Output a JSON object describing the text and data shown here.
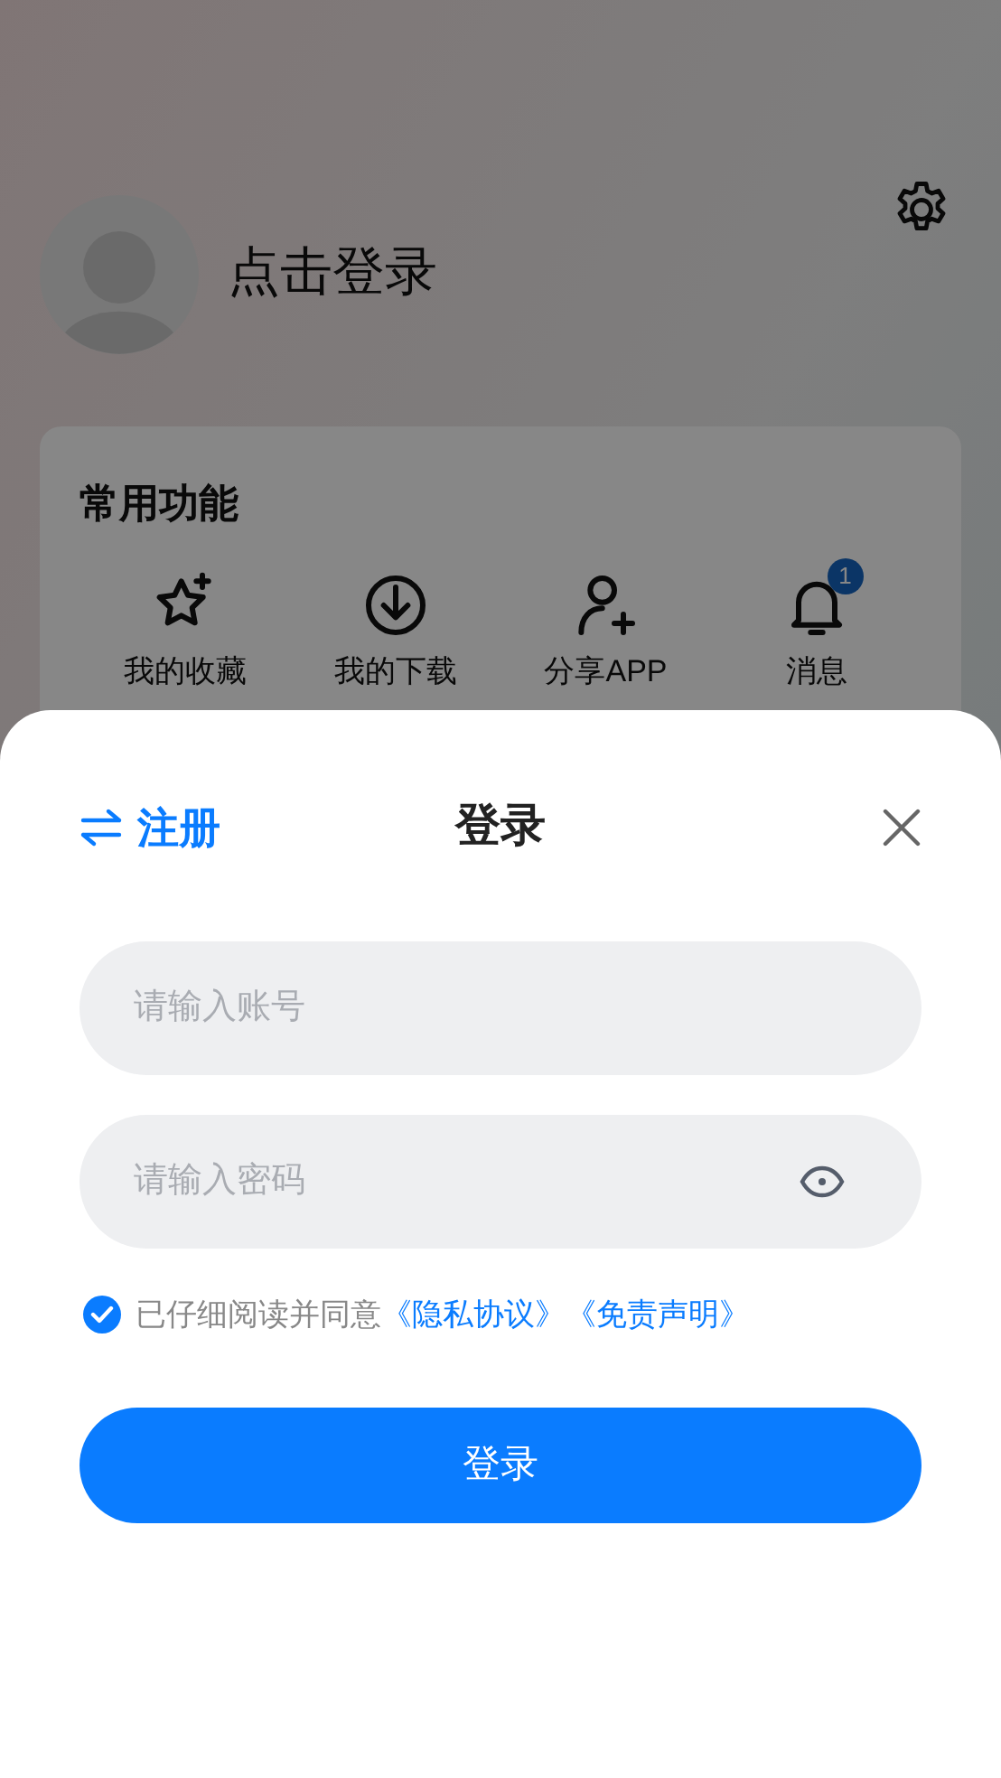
{
  "profile": {
    "login_prompt": "点击登录"
  },
  "features": {
    "title": "常用功能",
    "items": [
      {
        "label": "我的收藏",
        "kind": "star"
      },
      {
        "label": "我的下载",
        "kind": "download"
      },
      {
        "label": "分享APP",
        "kind": "share"
      },
      {
        "label": "消息",
        "kind": "bell",
        "badge": "1"
      }
    ]
  },
  "login_sheet": {
    "register_link": "注册",
    "title": "登录",
    "fields": [
      {
        "placeholder": "请输入账号",
        "kind": "text"
      },
      {
        "placeholder": "请输入密码",
        "kind": "password"
      }
    ],
    "agreement": {
      "checked": true,
      "text": "已仔细阅读并同意",
      "links": [
        "《隐私协议》",
        "《免责声明》"
      ]
    },
    "submit": "登录"
  }
}
